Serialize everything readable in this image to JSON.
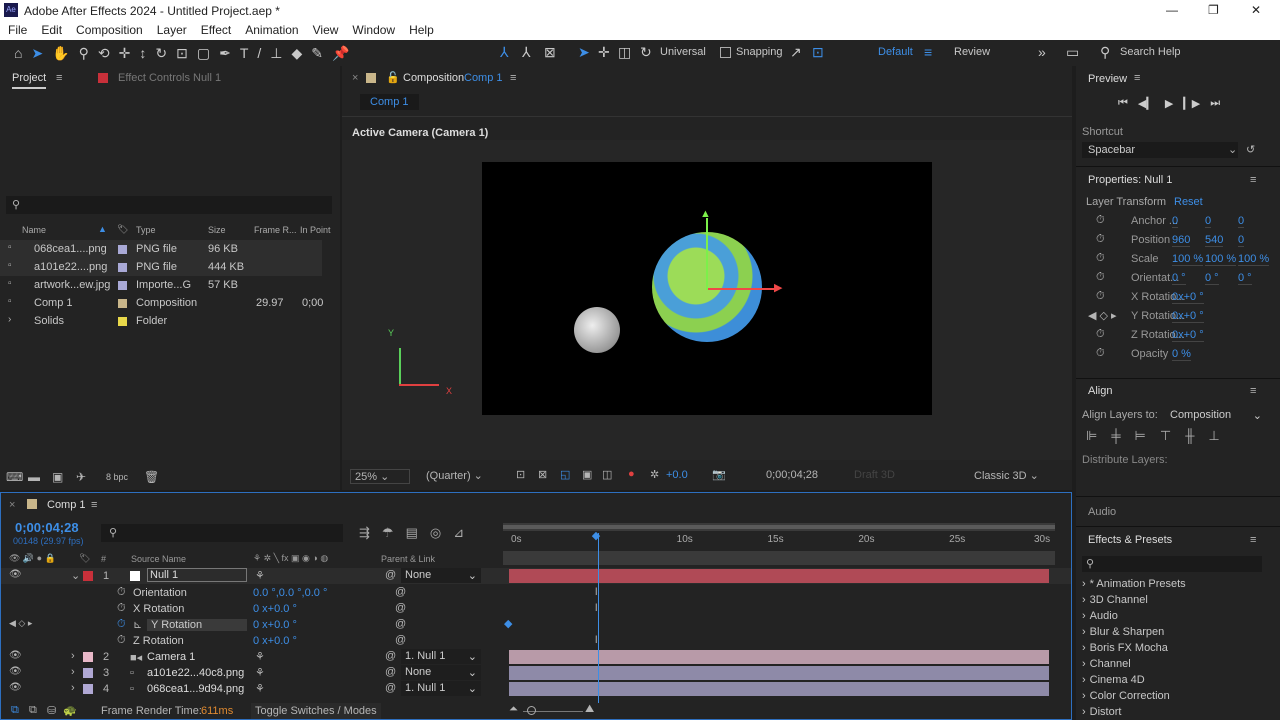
{
  "window": {
    "title": "Adobe After Effects 2024 - Untitled Project.aep *",
    "controls": [
      "—",
      "❐",
      "✕"
    ]
  },
  "menu": [
    "File",
    "Edit",
    "Composition",
    "Layer",
    "Effect",
    "Animation",
    "View",
    "Window",
    "Help"
  ],
  "toolbar": {
    "universal": "Universal",
    "snapping": "Snapping",
    "workspaces": [
      "Default",
      "Review"
    ],
    "search": "Search Help"
  },
  "project": {
    "tab": "Project",
    "effect_controls": "Effect Controls Null 1",
    "columns": [
      "Name",
      "Type",
      "Size",
      "Frame R...",
      "In Point"
    ],
    "items": [
      {
        "name": "068cea1....png",
        "type": "PNG file",
        "size": "96 KB",
        "fr": "",
        "in": "",
        "color": "#a9a9d6"
      },
      {
        "name": "a101e22....png",
        "type": "PNG file",
        "size": "444 KB",
        "fr": "",
        "in": "",
        "color": "#a9a9d6"
      },
      {
        "name": "artwork...ew.jpg",
        "type": "Importe...G",
        "size": "57 KB",
        "fr": "",
        "in": "",
        "color": "#a9a9d6"
      },
      {
        "name": "Comp 1",
        "type": "Composition",
        "size": "",
        "fr": "29.97",
        "in": "0;00",
        "color": "#c9b68a"
      },
      {
        "name": "Solids",
        "type": "Folder",
        "size": "",
        "fr": "",
        "in": "",
        "color": "#e8d84a"
      }
    ],
    "bpc": "8 bpc"
  },
  "composition": {
    "tab_prefix": "Composition",
    "tab_name": "Comp 1",
    "subtab": "Comp 1",
    "camera": "Active Camera (Camera 1)",
    "zoom": "25%",
    "quality": "(Quarter)",
    "exposure": "+0.0",
    "timecode": "0;00;04;28",
    "draft": "Draft 3D",
    "renderer": "Classic 3D",
    "axis_y": "Y",
    "axis_x": "X"
  },
  "preview": {
    "title": "Preview",
    "shortcut_label": "Shortcut",
    "shortcut": "Spacebar"
  },
  "properties": {
    "title": "Properties: Null 1",
    "section": "Layer Transform",
    "reset": "Reset",
    "rows": [
      {
        "label": "Anchor ...",
        "v": [
          "0",
          "0",
          "0"
        ]
      },
      {
        "label": "Position",
        "v": [
          "960",
          "540",
          "0"
        ]
      },
      {
        "label": "Scale",
        "v": [
          "100 %",
          "100 %",
          "100 %"
        ]
      },
      {
        "label": "Orientat...",
        "v": [
          "0 °",
          "0 °",
          "0 °"
        ]
      },
      {
        "label": "X Rotatio...",
        "v": [
          "0x+0 °"
        ]
      },
      {
        "label": "Y Rotatio...",
        "v": [
          "0x+0 °"
        ]
      },
      {
        "label": "Z Rotatio...",
        "v": [
          "0x+0 °"
        ]
      },
      {
        "label": "Opacity",
        "v": [
          "0 %"
        ]
      }
    ]
  },
  "align": {
    "title": "Align",
    "align_to_label": "Align Layers to:",
    "align_to": "Composition",
    "distribute": "Distribute Layers:"
  },
  "audio": {
    "title": "Audio"
  },
  "effects": {
    "title": "Effects & Presets",
    "items": [
      "* Animation Presets",
      "3D Channel",
      "Audio",
      "Blur & Sharpen",
      "Boris FX Mocha",
      "Channel",
      "Cinema 4D",
      "Color Correction",
      "Distort"
    ]
  },
  "timeline": {
    "tab": "Comp 1",
    "timecode": "0;00;04;28",
    "frames": "00148 (29.97 fps)",
    "source_name": "Source Name",
    "parent_link": "Parent & Link",
    "ruler": [
      "0s",
      "10s",
      "15s",
      "20s",
      "25s",
      "30s"
    ],
    "current_time_sec": 4.93,
    "duration_sec": 30,
    "layers": [
      {
        "num": "1",
        "name": "Null 1",
        "color": "#c8303a",
        "parent": "None"
      },
      {
        "num": "2",
        "name": "Camera 1",
        "color": "#e8b8c8",
        "parent": "1. Null 1"
      },
      {
        "num": "3",
        "name": "a101e22...40c8.png",
        "color": "#b0a8d4",
        "parent": "None"
      },
      {
        "num": "4",
        "name": "068cea1...9d94.png",
        "color": "#b0a8d4",
        "parent": "1. Null 1"
      }
    ],
    "props": [
      {
        "name": "Orientation",
        "value": "0.0 °,0.0 °,0.0 °"
      },
      {
        "name": "X Rotation",
        "value": "0 x+0.0 °"
      },
      {
        "name": "Y Rotation",
        "value": "0 x+0.0 °"
      },
      {
        "name": "Z Rotation",
        "value": "0 x+0.0 °"
      }
    ],
    "render_label": "Frame Render Time:",
    "render_time": "611ms",
    "toggle": "Toggle Switches / Modes"
  }
}
